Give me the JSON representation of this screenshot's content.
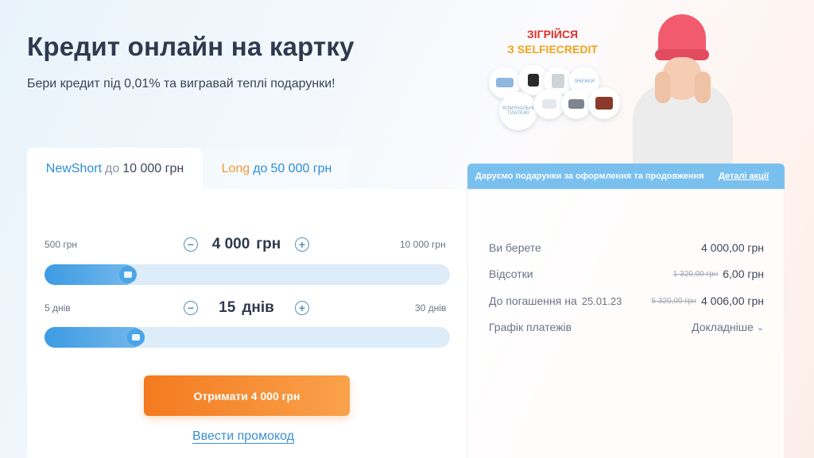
{
  "hero": {
    "title": "Кредит онлайн на картку",
    "subtitle": "Бери кредит під 0,01% та вигравай теплі подарунки!"
  },
  "promo": {
    "line1": "ЗІГРІЙСЯ",
    "line2": "З SELFIECREDIT",
    "gift_labels": [
      "ЗНИЖКИ",
      "КОМУНАЛЬНІ ПЛАТЕЖІ"
    ]
  },
  "tabs": [
    {
      "name": "NewShort",
      "upto": "до",
      "amount": "10 000 грн",
      "active": true
    },
    {
      "name": "Long",
      "upto": "до",
      "amount": "50 000 грн",
      "active": false
    }
  ],
  "amount_slider": {
    "min_label": "500 грн",
    "max_label": "10 000 грн",
    "value": "4 000",
    "unit": "грн",
    "minus": "−",
    "plus": "+",
    "fraction": 0.2
  },
  "days_slider": {
    "min_label": "5 днів",
    "max_label": "30 днів",
    "value": "15",
    "unit": "днів",
    "minus": "−",
    "plus": "+",
    "fraction": 0.22
  },
  "cta_label": "Отримати 4 000 грн",
  "promocode_link": "Ввести промокод",
  "banner": {
    "text": "Даруємо подарунки за оформлення та продовження",
    "link": "Деталі акції"
  },
  "summary": {
    "rows": [
      {
        "label": "Ви берете",
        "old": "",
        "value": "4 000,00 грн"
      },
      {
        "label": "Відсотки",
        "old": "1 320,00 грн",
        "value": "6,00 грн"
      },
      {
        "label": "До погашення на",
        "date": "25.01.23",
        "old": "5 320,00 грн",
        "value": "4 006,00 грн"
      }
    ],
    "schedule_label": "Графік платежів",
    "schedule_more": "Докладніше"
  },
  "colors": {
    "accent_blue": "#2b8fd6",
    "accent_orange": "#f47a1f",
    "promo_red": "#e0312b",
    "promo_yellow": "#f0a41a"
  }
}
